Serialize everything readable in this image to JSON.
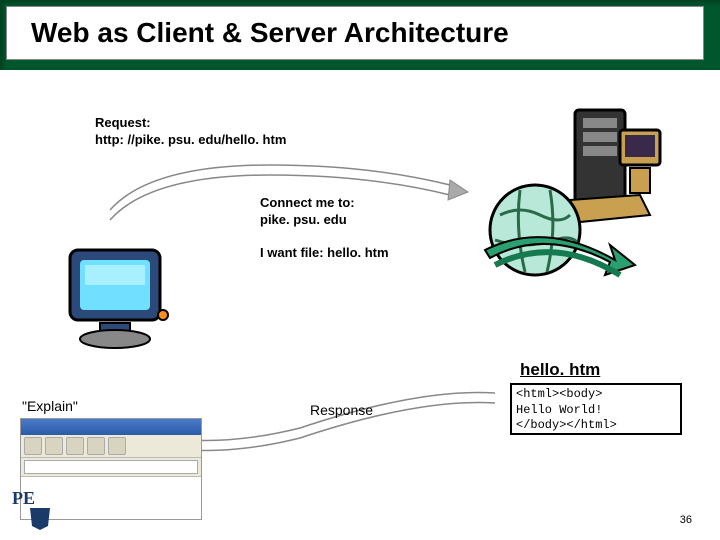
{
  "title": "Web as Client & Server Architecture",
  "request": {
    "label": "Request:",
    "url": "http: //pike. psu. edu/hello. htm"
  },
  "connect": {
    "label": "Connect me to:",
    "host": "pike. psu. edu"
  },
  "want_file": "I want file: hello. htm",
  "file_name": "hello. htm",
  "explain": "\"Explain\"",
  "response_label": "Response",
  "html_content": {
    "line1": "<html><body>",
    "line2": "Hello World!",
    "line3": "</body></html>"
  },
  "page_number": "36",
  "penn_label": "PE"
}
